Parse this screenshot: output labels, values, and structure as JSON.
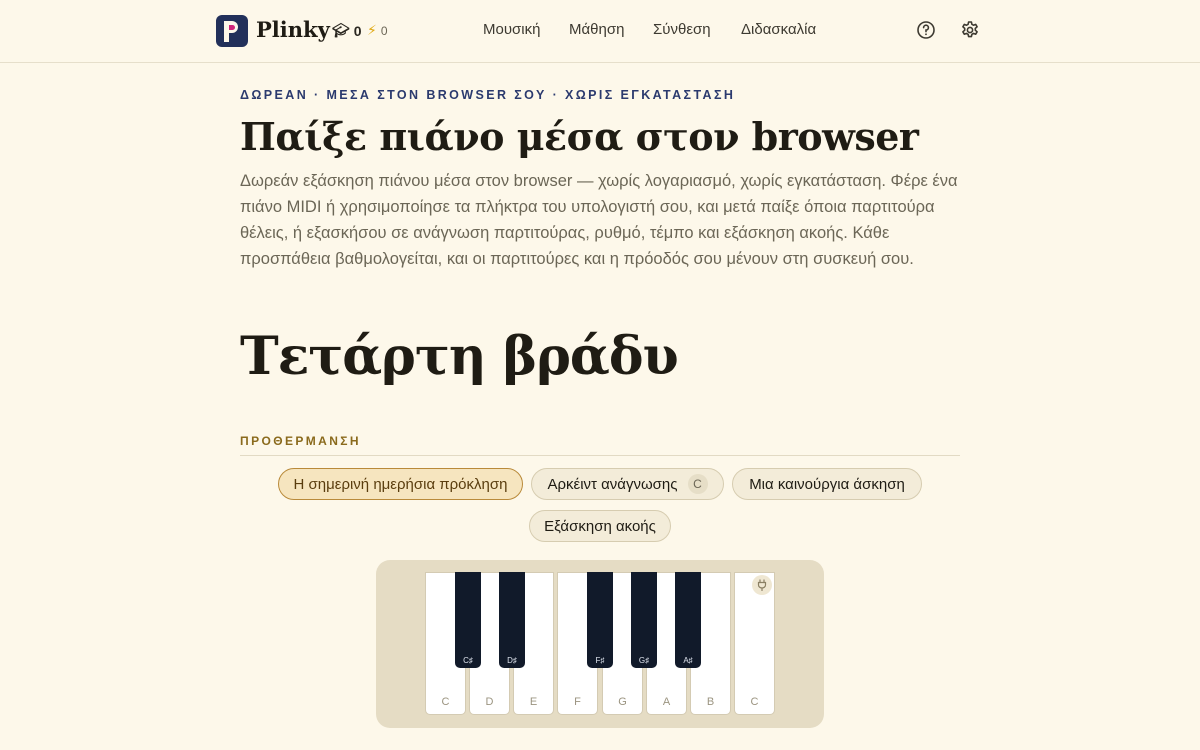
{
  "header": {
    "brand": "Plinky",
    "streak_count": "0",
    "energy_count": "0",
    "nav": [
      "Μουσική",
      "Μάθηση",
      "Σύνθεση",
      "Διδασκαλία"
    ],
    "icons": [
      "graduation-cap-icon",
      "lightning-icon",
      "help-circle-icon",
      "gear-icon"
    ]
  },
  "hero": {
    "eyebrow": "ΔΩΡΕΑΝ · ΜΕΣΑ ΣΤΟΝ BROWSER ΣΟΥ · ΧΩΡΙΣ ΕΓΚΑΤΑΣΤΑΣΗ",
    "title": "Παίξε πιάνο μέσα στον browser",
    "lead": "Δωρεάν εξάσκηση πιάνου μέσα στον browser — χωρίς λογαριασμό, χωρίς εγκατάσταση. Φέρε ένα πιάνο MIDI ή χρησιμοποίησε τα πλήκτρα του υπολογιστή σου, και μετά παίξε όποια παρτιτούρα θέλεις, ή εξασκήσου σε ανάγνωση παρτιτούρας, ρυθμό, τέμπο και εξάσκηση ακοής. Κάθε προσπάθεια βαθμολογείται, και οι παρτιτούρες και η πρόοδός σου μένουν στη συσκευή σου."
  },
  "greeting": "Τετάρτη βράδυ",
  "warmup": {
    "label": "ΠΡΟΘΕΡΜΑΝΣΗ",
    "chips": [
      {
        "label": "Η σημερινή ημερήσια πρόκληση",
        "active": true
      },
      {
        "label": "Αρκέιντ ανάγνωσης",
        "badge": "C"
      },
      {
        "label": "Μια καινούργια άσκηση"
      },
      {
        "label": "Εξάσκηση ακοής"
      }
    ]
  },
  "piano": {
    "white_keys": [
      "C",
      "D",
      "E",
      "F",
      "G",
      "A",
      "B",
      "C"
    ],
    "black_keys": [
      "C♯",
      "D♯",
      "F♯",
      "G♯",
      "A♯"
    ],
    "colors": {
      "white": "#ffffff",
      "black": "#111a2a",
      "frame": "#e5dcc4"
    }
  },
  "colors": {
    "background": "#fdf8ea",
    "brand": "#22305a",
    "accent": "#8a6a1c"
  }
}
